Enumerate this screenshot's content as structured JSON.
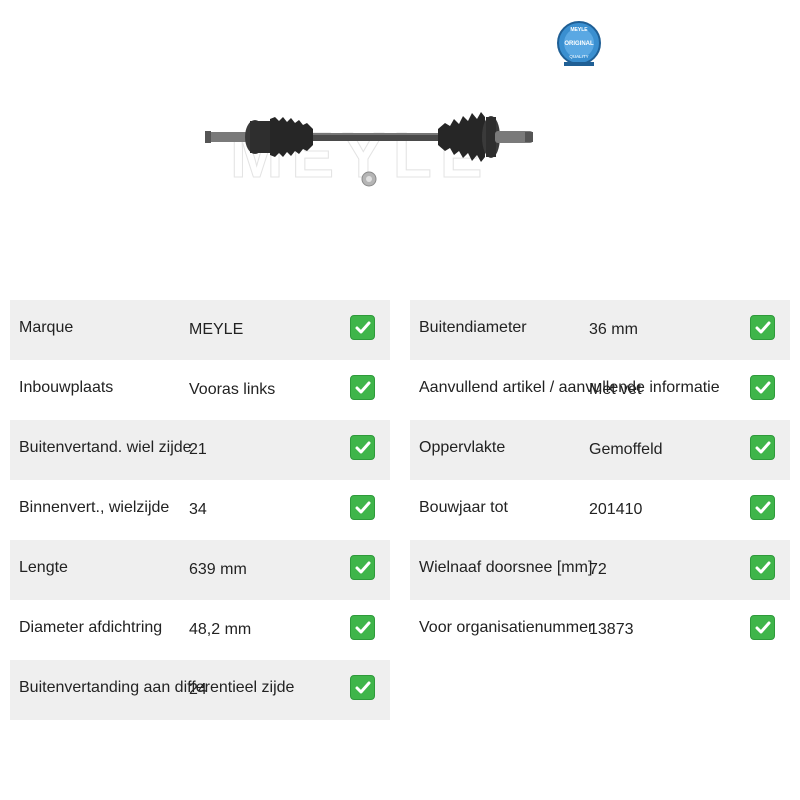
{
  "product": {
    "image_icon": "drive-shaft-image",
    "watermark": "MEYLE",
    "badge": {
      "top_text": "MEYLE",
      "center_text": "ORIGINAL",
      "bottom_text": "QUALITY"
    }
  },
  "colors": {
    "check": "#3fb54a",
    "row_alt": "#efefef",
    "badge": "#3a8fd0"
  },
  "left_table": [
    {
      "label": "Marque",
      "value": "MEYLE"
    },
    {
      "label": "Inbouwplaats",
      "value": "Vooras links"
    },
    {
      "label": "Buitenvertand. wiel zijde",
      "value": "21"
    },
    {
      "label": "Binnenvert., wielzijde",
      "value": "34"
    },
    {
      "label": "Lengte",
      "value": "639 mm"
    },
    {
      "label": "Diameter afdichtring",
      "value": "48,2 mm"
    },
    {
      "label": "Buitenvertanding aan differentieel zijde",
      "value": "24"
    }
  ],
  "right_table": [
    {
      "label": "Buitendiameter",
      "value": "36 mm"
    },
    {
      "label": "Aanvullend artikel / aanvullende informatie",
      "value": "Met vet"
    },
    {
      "label": "Oppervlakte",
      "value": "Gemoffeld"
    },
    {
      "label": "Bouwjaar tot",
      "value": "201410"
    },
    {
      "label": "Wielnaaf doorsnee [mm]",
      "value": "72"
    },
    {
      "label": "Voor organisatienummer",
      "value": "13873"
    }
  ]
}
